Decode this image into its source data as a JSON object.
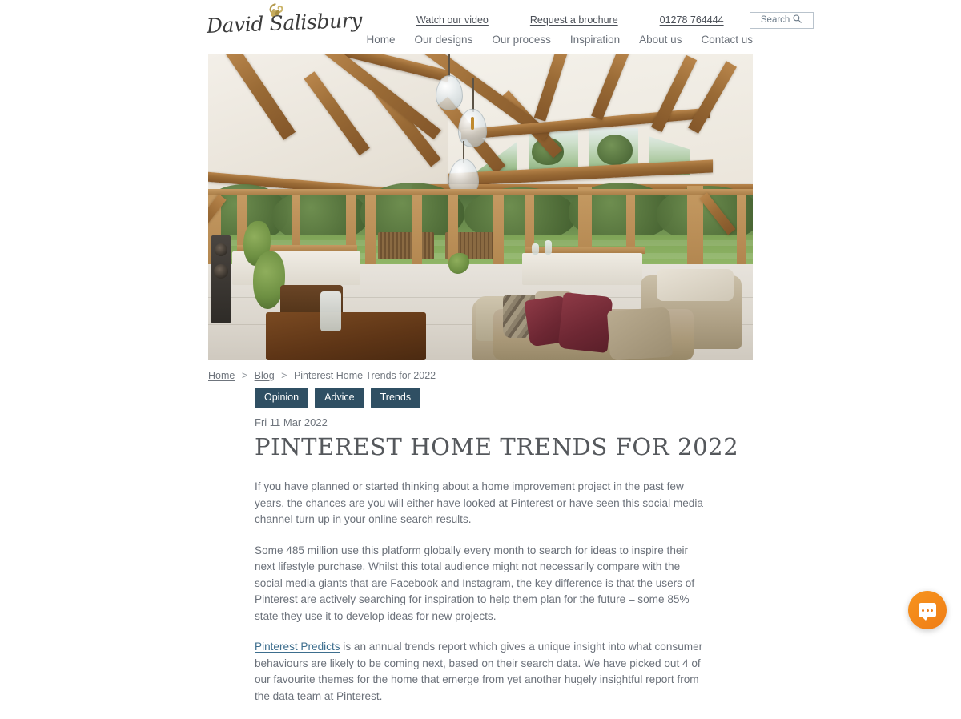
{
  "header": {
    "logo": {
      "wordmark": "David Salisbury",
      "leaf_icon": "leaf-icon"
    },
    "utility_links": [
      {
        "label": "Watch our video",
        "name": "watch-our-video-link"
      },
      {
        "label": "Request a brochure",
        "name": "request-a-brochure-link"
      },
      {
        "label": "01278 764444",
        "name": "phone-number-link"
      }
    ],
    "search": {
      "placeholder": "Search",
      "icon": "search-icon"
    },
    "nav_items": [
      {
        "label": "Home"
      },
      {
        "label": "Our designs"
      },
      {
        "label": "Our process"
      },
      {
        "label": "Inspiration"
      },
      {
        "label": "About us"
      },
      {
        "label": "Contact us"
      }
    ]
  },
  "hero": {
    "alt": "Oak framed garden room with vaulted ceiling, exposed oak beams, glass pendant lights and bi-fold doors opening onto a striped lawn"
  },
  "breadcrumb": {
    "home": "Home",
    "blog": "Blog",
    "current": "Pinterest Home Trends for 2022",
    "separator": ">"
  },
  "tags": [
    {
      "label": "Opinion"
    },
    {
      "label": "Advice"
    },
    {
      "label": "Trends"
    }
  ],
  "article": {
    "date": "Fri 11 Mar 2022",
    "title": "PINTEREST HOME TRENDS FOR 2022",
    "paragraph_1": "If you have planned or started thinking about a home improvement project in the past few years, the chances are you will either have looked at Pinterest or have seen this social media channel turn up in your online search results.",
    "paragraph_2": "Some 485 million use this platform globally every month to search for ideas to inspire their next lifestyle purchase. Whilst this total audience might not necessarily compare with the social media giants that are Facebook and Instagram, the key difference is that the users of Pinterest are actively searching for inspiration to help them plan for the future – some 85% state they use it to develop ideas for new projects.",
    "paragraph_3_link": "Pinterest Predicts",
    "paragraph_3_rest": " is an annual trends report which gives a unique insight into what consumer behaviours are likely to be coming next, based on their search data. We have picked out 4 of our favourite themes for the home that emerge from yet another hugely insightful report from the data team at Pinterest."
  },
  "chat": {
    "label": "Open chat",
    "icon": "chat-bubble-icon",
    "color": "#f7941e"
  },
  "colors": {
    "tag_pill": "#2f4f63",
    "link": "#3d6e8e",
    "body_text": "#6b717a",
    "title_text": "#55585c",
    "chat_accent": "#f7941e"
  }
}
